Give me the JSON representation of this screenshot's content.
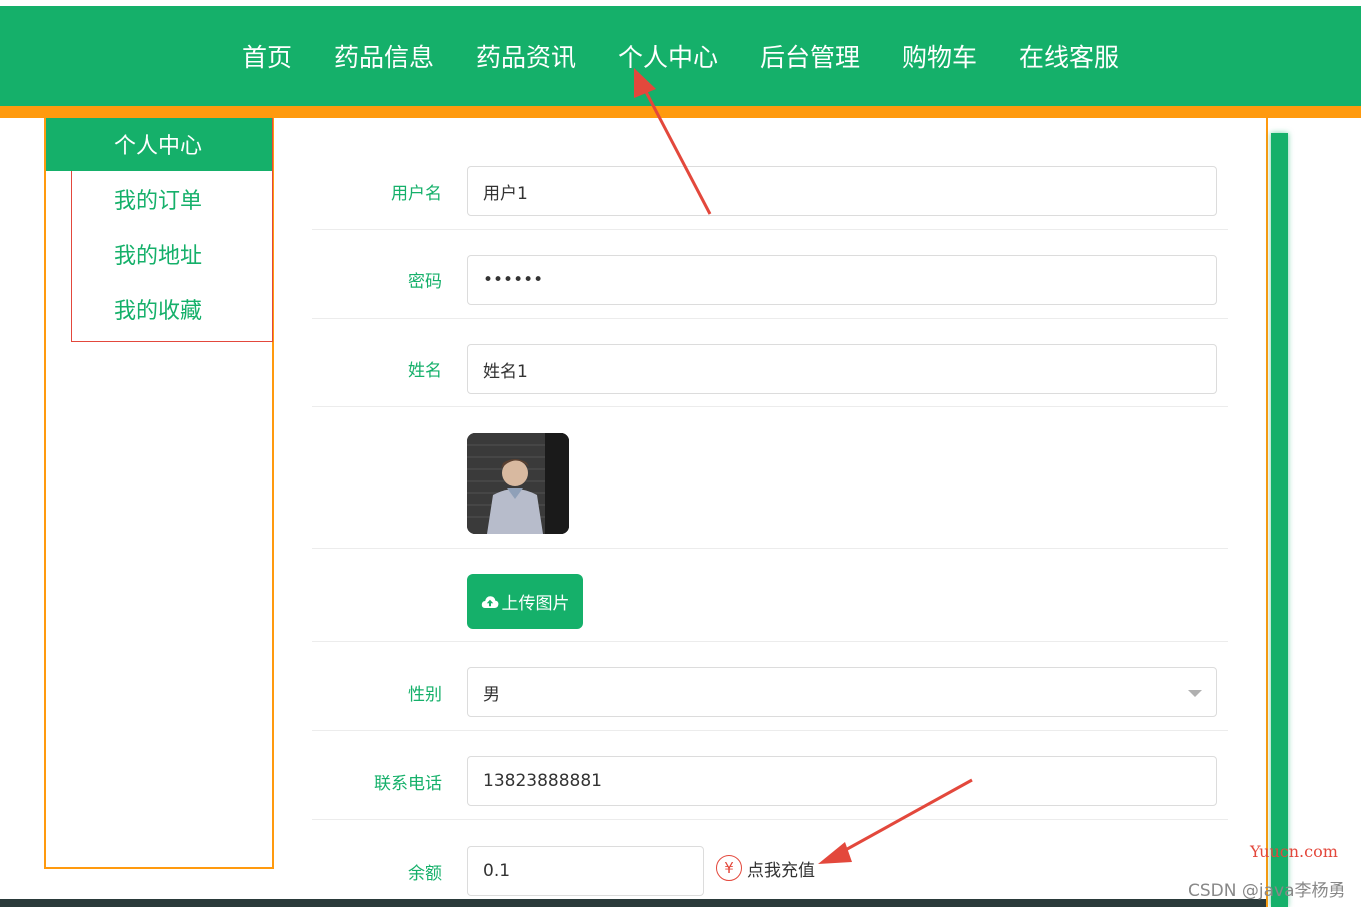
{
  "nav": {
    "items": [
      {
        "label": "首页"
      },
      {
        "label": "药品信息"
      },
      {
        "label": "药品资讯"
      },
      {
        "label": "个人中心"
      },
      {
        "label": "后台管理"
      },
      {
        "label": "购物车"
      },
      {
        "label": "在线客服"
      }
    ]
  },
  "sidebar": {
    "items": [
      {
        "label": "个人中心",
        "active": true
      },
      {
        "label": "我的订单"
      },
      {
        "label": "我的地址"
      },
      {
        "label": "我的收藏"
      }
    ]
  },
  "form": {
    "username": {
      "label": "用户名",
      "value": "用户1"
    },
    "password": {
      "label": "密码",
      "value": "••••••"
    },
    "name": {
      "label": "姓名",
      "value": "姓名1"
    },
    "upload": {
      "label": "上传图片"
    },
    "gender": {
      "label": "性别",
      "value": "男"
    },
    "phone": {
      "label": "联系电话",
      "value": "13823888881"
    },
    "balance": {
      "label": "余额",
      "value": "0.1",
      "recharge_symbol": "¥",
      "recharge_label": "点我充值"
    }
  },
  "watermark": {
    "site": "Yuucn.com",
    "author": "CSDN @java李杨勇"
  },
  "colors": {
    "primary": "#15b06a",
    "accent": "#ff9a0e",
    "annotation": "#e3483c"
  }
}
